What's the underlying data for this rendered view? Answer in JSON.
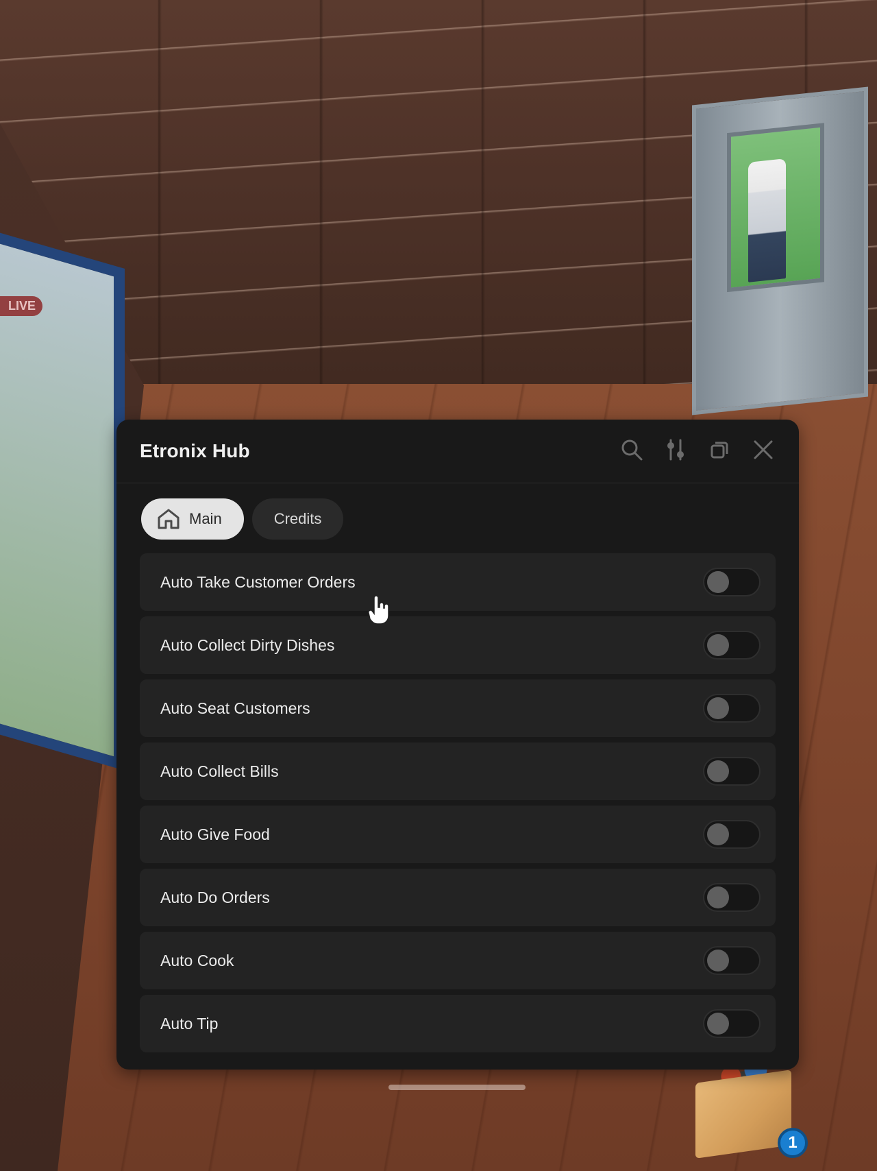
{
  "scene": {
    "live_badge": "LIVE",
    "notification_count": "1"
  },
  "hub": {
    "title": "Etronix Hub",
    "tools": [
      "search-icon",
      "settings-sliders-icon",
      "minimize-icon",
      "close-icon"
    ],
    "tabs": [
      {
        "label": "Main",
        "icon": "home-icon",
        "active": true
      },
      {
        "label": "Credits",
        "active": false
      }
    ],
    "toggles": [
      {
        "label": "Auto Take Customer Orders",
        "on": false
      },
      {
        "label": "Auto Collect Dirty Dishes",
        "on": false
      },
      {
        "label": "Auto Seat Customers",
        "on": false
      },
      {
        "label": "Auto Collect Bills",
        "on": false
      },
      {
        "label": "Auto Give Food",
        "on": false
      },
      {
        "label": "Auto Do Orders",
        "on": false
      },
      {
        "label": "Auto Cook",
        "on": false
      },
      {
        "label": "Auto Tip",
        "on": false
      }
    ]
  },
  "colors": {
    "panel_bg": "#191919",
    "row_bg": "#232323",
    "active_tab_bg": "#e4e4e4",
    "switch_off_knob": "#5f5f5f",
    "badge_blue": "#1a7fd1"
  }
}
